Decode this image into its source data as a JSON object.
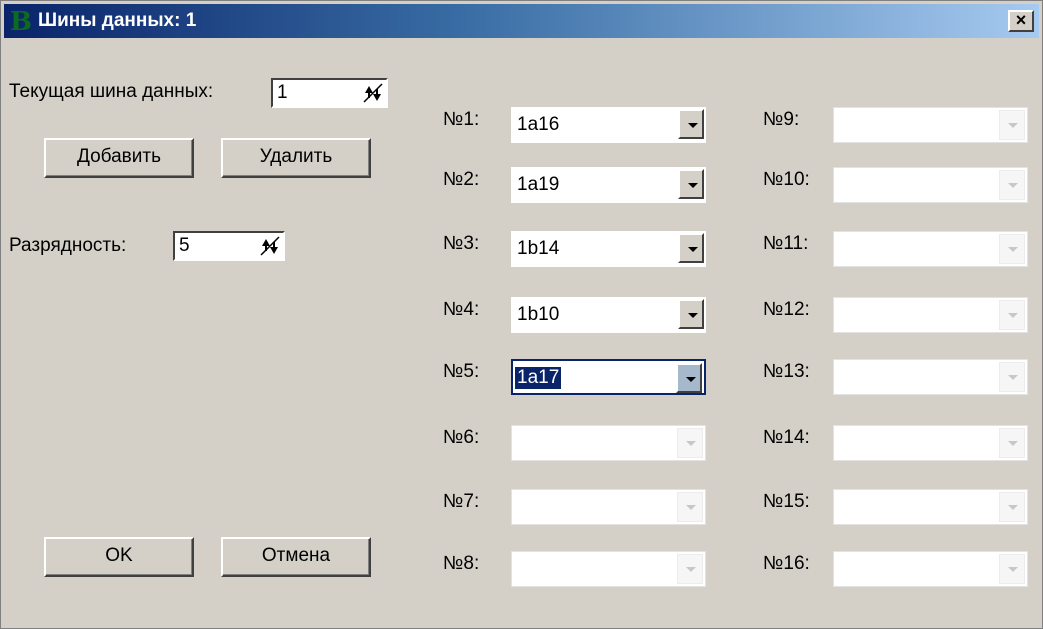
{
  "window": {
    "title": "Шины данных: 1",
    "app_icon_glyph": "B",
    "close_label": "×"
  },
  "current_bus": {
    "label": "Текущая шина данных:",
    "value": "1"
  },
  "buttons": {
    "add": "Добавить",
    "delete": "Удалить",
    "ok": "OK",
    "cancel": "Отмена"
  },
  "width": {
    "label": "Разрядность:",
    "value": "5"
  },
  "channels": [
    {
      "label": "№1:",
      "value": "1a16",
      "enabled": true
    },
    {
      "label": "№2:",
      "value": "1a19",
      "enabled": true
    },
    {
      "label": "№3:",
      "value": "1b14",
      "enabled": true
    },
    {
      "label": "№4:",
      "value": "1b10",
      "enabled": true
    },
    {
      "label": "№5:",
      "value": "1a17",
      "enabled": true,
      "focused": true
    },
    {
      "label": "№6:",
      "value": "",
      "enabled": false
    },
    {
      "label": "№7:",
      "value": "",
      "enabled": false
    },
    {
      "label": "№8:",
      "value": "",
      "enabled": false
    },
    {
      "label": "№9:",
      "value": "",
      "enabled": false
    },
    {
      "label": "№10:",
      "value": "",
      "enabled": false
    },
    {
      "label": "№11:",
      "value": "",
      "enabled": false
    },
    {
      "label": "№12:",
      "value": "",
      "enabled": false
    },
    {
      "label": "№13:",
      "value": "",
      "enabled": false
    },
    {
      "label": "№14:",
      "value": "",
      "enabled": false
    },
    {
      "label": "№15:",
      "value": "",
      "enabled": false
    },
    {
      "label": "№16:",
      "value": "",
      "enabled": false
    }
  ],
  "colors": {
    "titlebar_start": "#0a246a",
    "titlebar_end": "#a6caf0",
    "face": "#d4d0c8",
    "selection": "#0a246a"
  }
}
